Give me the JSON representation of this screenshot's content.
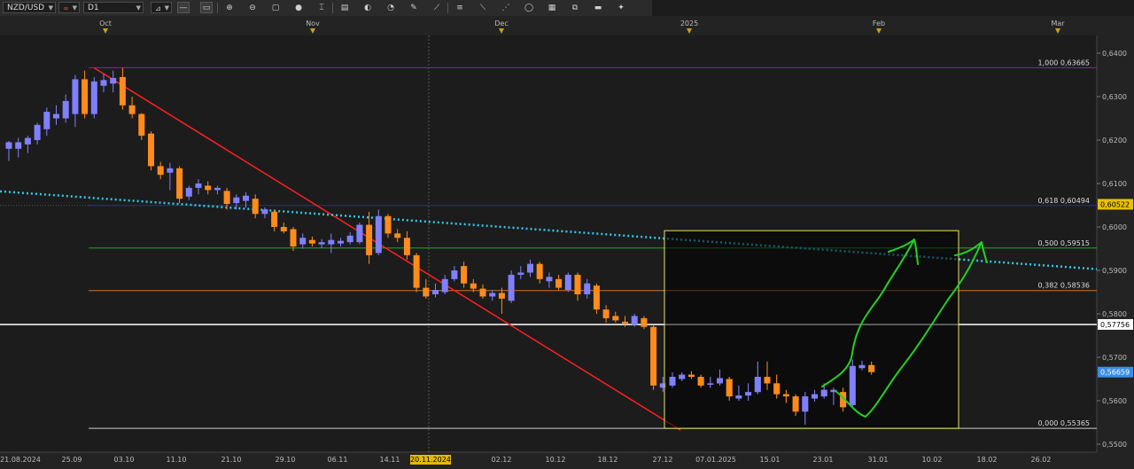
{
  "toolbar": {
    "symbol": "NZD/USD",
    "link_icon": "link-icon",
    "timeframe": "D1",
    "tools": [
      "chart-type-icon",
      "line-icon",
      "volume-icon",
      "zoom-in-icon",
      "zoom-out-icon",
      "fit-icon",
      "crosshair-icon",
      "text-icon",
      "template-icon",
      "indicator-icon",
      "pencil-icon",
      "eraser-icon",
      "fib-icon",
      "channel-icon",
      "gann-icon",
      "shapes-icon",
      "objects-icon",
      "clone-icon",
      "ruler-icon",
      "settings-icon"
    ]
  },
  "colors": {
    "background": "#1c1c1c",
    "bull": "#8080ff",
    "bear": "#ff8c1a",
    "trendline": "#ff2020",
    "dotted_line": "#32c8e8",
    "box": "#e6e664",
    "arrow": "#23d023",
    "level_white": "#ffffff",
    "fib_1000": "#8a2a8a",
    "fib_618": "#2a2aaa",
    "fib_500": "#22aa22",
    "fib_382": "#d07020",
    "fib_000": "#cccccc"
  },
  "chart_data": {
    "type": "candlestick",
    "symbol": "NZD/USD",
    "timeframe": "D1",
    "ylim": [
      0.5535,
      0.6415
    ],
    "y_ticks": [
      "0,6400",
      "0,6300",
      "0,6200",
      "0,6100",
      "0,6000",
      "0,5900",
      "0,5800",
      "0,5700",
      "0,5600",
      "0,5500"
    ],
    "x_labels": [
      "21.08.2024",
      "25.09",
      "03.10",
      "11.10",
      "21.10",
      "29.10",
      "06.11",
      "14.11",
      "20.11.2024",
      "02.12",
      "10.12",
      "18.12",
      "27.12",
      "07.01.2025",
      "15.01",
      "23.01",
      "31.01",
      "10.02",
      "18.02",
      "26.02"
    ],
    "month_labels": [
      "Oct",
      "Nov",
      "Dec",
      "2025",
      "Feb",
      "Mar"
    ],
    "highlighted_date": "20.11.2024",
    "price_labels": [
      {
        "text": "0,60522",
        "color": "yellow"
      },
      {
        "text": "0,57756",
        "color": "white"
      },
      {
        "text": "0,56659",
        "color": "blue"
      }
    ],
    "fib_levels": [
      {
        "label": "1,000_0,63665",
        "value": 0.63665
      },
      {
        "label": "0,618_0,60494",
        "value": 0.60494
      },
      {
        "label": "0,500_0,59515",
        "value": 0.59515
      },
      {
        "label": "0,382_0,58536",
        "value": 0.58536
      },
      {
        "label": "0,000_0,55365",
        "value": 0.55365
      }
    ],
    "horizontal_level": 0.57756,
    "candles": [
      {
        "o": 0.618,
        "h": 0.6198,
        "l": 0.6152,
        "c": 0.6195
      },
      {
        "o": 0.618,
        "h": 0.6205,
        "l": 0.616,
        "c": 0.6195
      },
      {
        "o": 0.619,
        "h": 0.621,
        "l": 0.617,
        "c": 0.6205
      },
      {
        "o": 0.62,
        "h": 0.624,
        "l": 0.619,
        "c": 0.6235
      },
      {
        "o": 0.6225,
        "h": 0.6275,
        "l": 0.621,
        "c": 0.6265
      },
      {
        "o": 0.625,
        "h": 0.628,
        "l": 0.6235,
        "c": 0.626
      },
      {
        "o": 0.625,
        "h": 0.6305,
        "l": 0.624,
        "c": 0.629
      },
      {
        "o": 0.626,
        "h": 0.635,
        "l": 0.623,
        "c": 0.634
      },
      {
        "o": 0.634,
        "h": 0.636,
        "l": 0.625,
        "c": 0.626
      },
      {
        "o": 0.626,
        "h": 0.6345,
        "l": 0.625,
        "c": 0.6335
      },
      {
        "o": 0.6325,
        "h": 0.6352,
        "l": 0.631,
        "c": 0.6338
      },
      {
        "o": 0.633,
        "h": 0.636,
        "l": 0.631,
        "c": 0.6343
      },
      {
        "o": 0.6345,
        "h": 0.6366,
        "l": 0.627,
        "c": 0.628
      },
      {
        "o": 0.628,
        "h": 0.63,
        "l": 0.625,
        "c": 0.626
      },
      {
        "o": 0.626,
        "h": 0.6262,
        "l": 0.62,
        "c": 0.621
      },
      {
        "o": 0.6215,
        "h": 0.622,
        "l": 0.613,
        "c": 0.614
      },
      {
        "o": 0.614,
        "h": 0.615,
        "l": 0.611,
        "c": 0.612
      },
      {
        "o": 0.6125,
        "h": 0.6148,
        "l": 0.6085,
        "c": 0.6135
      },
      {
        "o": 0.6135,
        "h": 0.614,
        "l": 0.6055,
        "c": 0.6065
      },
      {
        "o": 0.607,
        "h": 0.6095,
        "l": 0.6062,
        "c": 0.609
      },
      {
        "o": 0.609,
        "h": 0.611,
        "l": 0.6075,
        "c": 0.61
      },
      {
        "o": 0.6095,
        "h": 0.6105,
        "l": 0.6075,
        "c": 0.6085
      },
      {
        "o": 0.6085,
        "h": 0.6095,
        "l": 0.6075,
        "c": 0.609
      },
      {
        "o": 0.6083,
        "h": 0.609,
        "l": 0.604,
        "c": 0.6053
      },
      {
        "o": 0.6055,
        "h": 0.6075,
        "l": 0.604,
        "c": 0.6068
      },
      {
        "o": 0.606,
        "h": 0.608,
        "l": 0.6045,
        "c": 0.6072
      },
      {
        "o": 0.6065,
        "h": 0.6075,
        "l": 0.602,
        "c": 0.603
      },
      {
        "o": 0.603,
        "h": 0.6045,
        "l": 0.602,
        "c": 0.604
      },
      {
        "o": 0.6035,
        "h": 0.604,
        "l": 0.599,
        "c": 0.6
      },
      {
        "o": 0.6,
        "h": 0.601,
        "l": 0.5985,
        "c": 0.599
      },
      {
        "o": 0.5995,
        "h": 0.6,
        "l": 0.5945,
        "c": 0.5955
      },
      {
        "o": 0.596,
        "h": 0.5985,
        "l": 0.595,
        "c": 0.5975
      },
      {
        "o": 0.597,
        "h": 0.5978,
        "l": 0.5955,
        "c": 0.5962
      },
      {
        "o": 0.596,
        "h": 0.5972,
        "l": 0.5952,
        "c": 0.5965
      },
      {
        "o": 0.596,
        "h": 0.5985,
        "l": 0.594,
        "c": 0.597
      },
      {
        "o": 0.5962,
        "h": 0.5975,
        "l": 0.5955,
        "c": 0.5968
      },
      {
        "o": 0.5965,
        "h": 0.5988,
        "l": 0.596,
        "c": 0.598
      },
      {
        "o": 0.5965,
        "h": 0.601,
        "l": 0.596,
        "c": 0.6005
      },
      {
        "o": 0.6005,
        "h": 0.6035,
        "l": 0.5915,
        "c": 0.5935
      },
      {
        "o": 0.594,
        "h": 0.604,
        "l": 0.5935,
        "c": 0.6025
      },
      {
        "o": 0.6025,
        "h": 0.603,
        "l": 0.5975,
        "c": 0.5985
      },
      {
        "o": 0.5985,
        "h": 0.5995,
        "l": 0.5965,
        "c": 0.5975
      },
      {
        "o": 0.5975,
        "h": 0.599,
        "l": 0.5925,
        "c": 0.5935
      },
      {
        "o": 0.5935,
        "h": 0.594,
        "l": 0.585,
        "c": 0.586
      },
      {
        "o": 0.586,
        "h": 0.588,
        "l": 0.5835,
        "c": 0.584
      },
      {
        "o": 0.5845,
        "h": 0.587,
        "l": 0.5838,
        "c": 0.5855
      },
      {
        "o": 0.585,
        "h": 0.589,
        "l": 0.5845,
        "c": 0.588
      },
      {
        "o": 0.588,
        "h": 0.591,
        "l": 0.5875,
        "c": 0.59
      },
      {
        "o": 0.591,
        "h": 0.592,
        "l": 0.586,
        "c": 0.587
      },
      {
        "o": 0.587,
        "h": 0.588,
        "l": 0.585,
        "c": 0.5858
      },
      {
        "o": 0.5858,
        "h": 0.5868,
        "l": 0.5835,
        "c": 0.584
      },
      {
        "o": 0.584,
        "h": 0.5855,
        "l": 0.583,
        "c": 0.5848
      },
      {
        "o": 0.5848,
        "h": 0.586,
        "l": 0.58,
        "c": 0.5835
      },
      {
        "o": 0.583,
        "h": 0.59,
        "l": 0.5825,
        "c": 0.589
      },
      {
        "o": 0.589,
        "h": 0.591,
        "l": 0.588,
        "c": 0.5895
      },
      {
        "o": 0.5895,
        "h": 0.5925,
        "l": 0.5885,
        "c": 0.5915
      },
      {
        "o": 0.5915,
        "h": 0.592,
        "l": 0.587,
        "c": 0.588
      },
      {
        "o": 0.5875,
        "h": 0.5895,
        "l": 0.586,
        "c": 0.5885
      },
      {
        "o": 0.588,
        "h": 0.589,
        "l": 0.5855,
        "c": 0.586
      },
      {
        "o": 0.5855,
        "h": 0.5895,
        "l": 0.585,
        "c": 0.589
      },
      {
        "o": 0.589,
        "h": 0.5895,
        "l": 0.583,
        "c": 0.5845
      },
      {
        "o": 0.5845,
        "h": 0.588,
        "l": 0.5835,
        "c": 0.587
      },
      {
        "o": 0.5865,
        "h": 0.587,
        "l": 0.58,
        "c": 0.581
      },
      {
        "o": 0.581,
        "h": 0.582,
        "l": 0.578,
        "c": 0.579
      },
      {
        "o": 0.5795,
        "h": 0.5805,
        "l": 0.578,
        "c": 0.5785
      },
      {
        "o": 0.5782,
        "h": 0.5795,
        "l": 0.577,
        "c": 0.5778
      },
      {
        "o": 0.5775,
        "h": 0.58,
        "l": 0.577,
        "c": 0.5795
      },
      {
        "o": 0.579,
        "h": 0.5795,
        "l": 0.5765,
        "c": 0.577
      },
      {
        "o": 0.577,
        "h": 0.5775,
        "l": 0.5625,
        "c": 0.5635
      },
      {
        "o": 0.563,
        "h": 0.5655,
        "l": 0.562,
        "c": 0.564
      },
      {
        "o": 0.5635,
        "h": 0.5665,
        "l": 0.563,
        "c": 0.5655
      },
      {
        "o": 0.565,
        "h": 0.5665,
        "l": 0.5645,
        "c": 0.566
      },
      {
        "o": 0.566,
        "h": 0.5668,
        "l": 0.565,
        "c": 0.5655
      },
      {
        "o": 0.5655,
        "h": 0.566,
        "l": 0.563,
        "c": 0.5635
      },
      {
        "o": 0.5638,
        "h": 0.5655,
        "l": 0.563,
        "c": 0.564
      },
      {
        "o": 0.564,
        "h": 0.5672,
        "l": 0.5635,
        "c": 0.5652
      },
      {
        "o": 0.565,
        "h": 0.5655,
        "l": 0.56,
        "c": 0.561
      },
      {
        "o": 0.5605,
        "h": 0.5635,
        "l": 0.56,
        "c": 0.5612
      },
      {
        "o": 0.5612,
        "h": 0.564,
        "l": 0.56,
        "c": 0.562
      },
      {
        "o": 0.562,
        "h": 0.569,
        "l": 0.5615,
        "c": 0.5655
      },
      {
        "o": 0.5655,
        "h": 0.569,
        "l": 0.5625,
        "c": 0.564
      },
      {
        "o": 0.564,
        "h": 0.566,
        "l": 0.5605,
        "c": 0.5615
      },
      {
        "o": 0.5615,
        "h": 0.5625,
        "l": 0.5595,
        "c": 0.561
      },
      {
        "o": 0.561,
        "h": 0.5615,
        "l": 0.5565,
        "c": 0.5575
      },
      {
        "o": 0.5575,
        "h": 0.562,
        "l": 0.5545,
        "c": 0.561
      },
      {
        "o": 0.5605,
        "h": 0.5625,
        "l": 0.5598,
        "c": 0.5615
      },
      {
        "o": 0.561,
        "h": 0.564,
        "l": 0.5605,
        "c": 0.5625
      },
      {
        "o": 0.562,
        "h": 0.563,
        "l": 0.559,
        "c": 0.5625
      },
      {
        "o": 0.562,
        "h": 0.563,
        "l": 0.5575,
        "c": 0.5585
      },
      {
        "o": 0.559,
        "h": 0.5695,
        "l": 0.5585,
        "c": 0.568
      },
      {
        "o": 0.5675,
        "h": 0.5692,
        "l": 0.567,
        "c": 0.5682
      },
      {
        "o": 0.5682,
        "h": 0.569,
        "l": 0.566,
        "c": 0.5666
      }
    ]
  }
}
